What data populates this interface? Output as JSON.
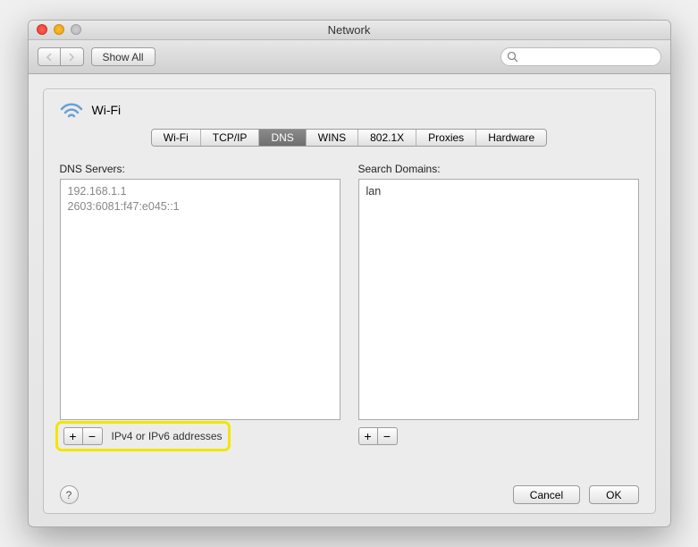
{
  "window": {
    "title": "Network"
  },
  "toolbar": {
    "show_all": "Show All"
  },
  "header": {
    "wifi_label": "Wi-Fi"
  },
  "tabs": [
    "Wi-Fi",
    "TCP/IP",
    "DNS",
    "WINS",
    "802.1X",
    "Proxies",
    "Hardware"
  ],
  "active_tab": "DNS",
  "dns": {
    "label": "DNS Servers:",
    "entries": [
      "192.168.1.1",
      "2603:6081:f47:e045::1"
    ],
    "hint": "IPv4 or IPv6 addresses"
  },
  "search_domains": {
    "label": "Search Domains:",
    "entries": [
      "lan"
    ]
  },
  "buttons": {
    "plus": "+",
    "minus": "−",
    "cancel": "Cancel",
    "ok": "OK",
    "help": "?"
  }
}
